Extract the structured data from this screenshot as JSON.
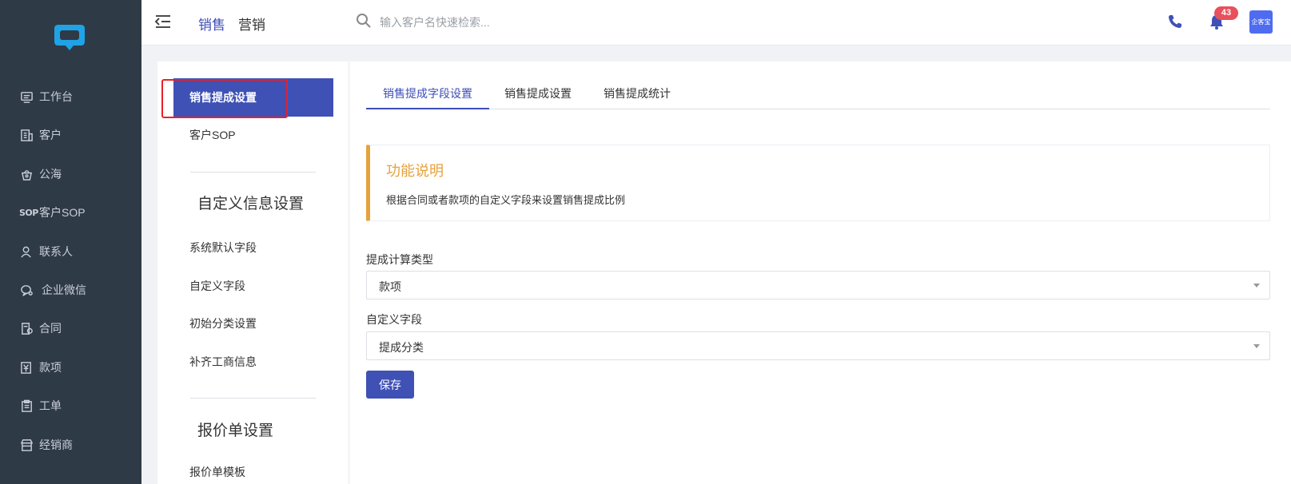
{
  "sidebar": {
    "items": [
      {
        "label": "工作台",
        "icon": "monitor-icon"
      },
      {
        "label": "客户",
        "icon": "building-icon"
      },
      {
        "label": "公海",
        "icon": "basket-icon"
      },
      {
        "label": "客户SOP",
        "icon_text": "SOP"
      },
      {
        "label": "联系人",
        "icon": "person-icon"
      },
      {
        "label": "企业微信",
        "icon": "chat-icon"
      },
      {
        "label": "合同",
        "icon": "contract-icon"
      },
      {
        "label": "款项",
        "icon": "yen-icon"
      },
      {
        "label": "工单",
        "icon": "clipboard-icon"
      },
      {
        "label": "经销商",
        "icon": "store-icon"
      }
    ]
  },
  "header": {
    "tabs": [
      "销售",
      "营销"
    ],
    "search_placeholder": "输入客户名快速检索...",
    "notification_count": "43",
    "avatar_text": "企客宝"
  },
  "settings_nav": {
    "items": [
      "销售提成设置",
      "客户SOP"
    ],
    "section1_title": "自定义信息设置",
    "section1_items": [
      "系统默认字段",
      "自定义字段",
      "初始分类设置",
      "补齐工商信息"
    ],
    "section2_title": "报价单设置",
    "section2_items": [
      "报价单模板"
    ]
  },
  "main": {
    "tabs": [
      "销售提成字段设置",
      "销售提成设置",
      "销售提成统计"
    ],
    "info_title": "功能说明",
    "info_text": "根据合同或者款项的自定义字段来设置销售提成比例",
    "field1_label": "提成计算类型",
    "field1_value": "款项",
    "field2_label": "自定义字段",
    "field2_value": "提成分类",
    "save_label": "保存"
  },
  "colors": {
    "primary": "#3f51b5",
    "sidebar_bg": "#2f3a47",
    "warning": "#e6a23c",
    "badge": "#e8505b",
    "logo": "#1fa3e6"
  }
}
